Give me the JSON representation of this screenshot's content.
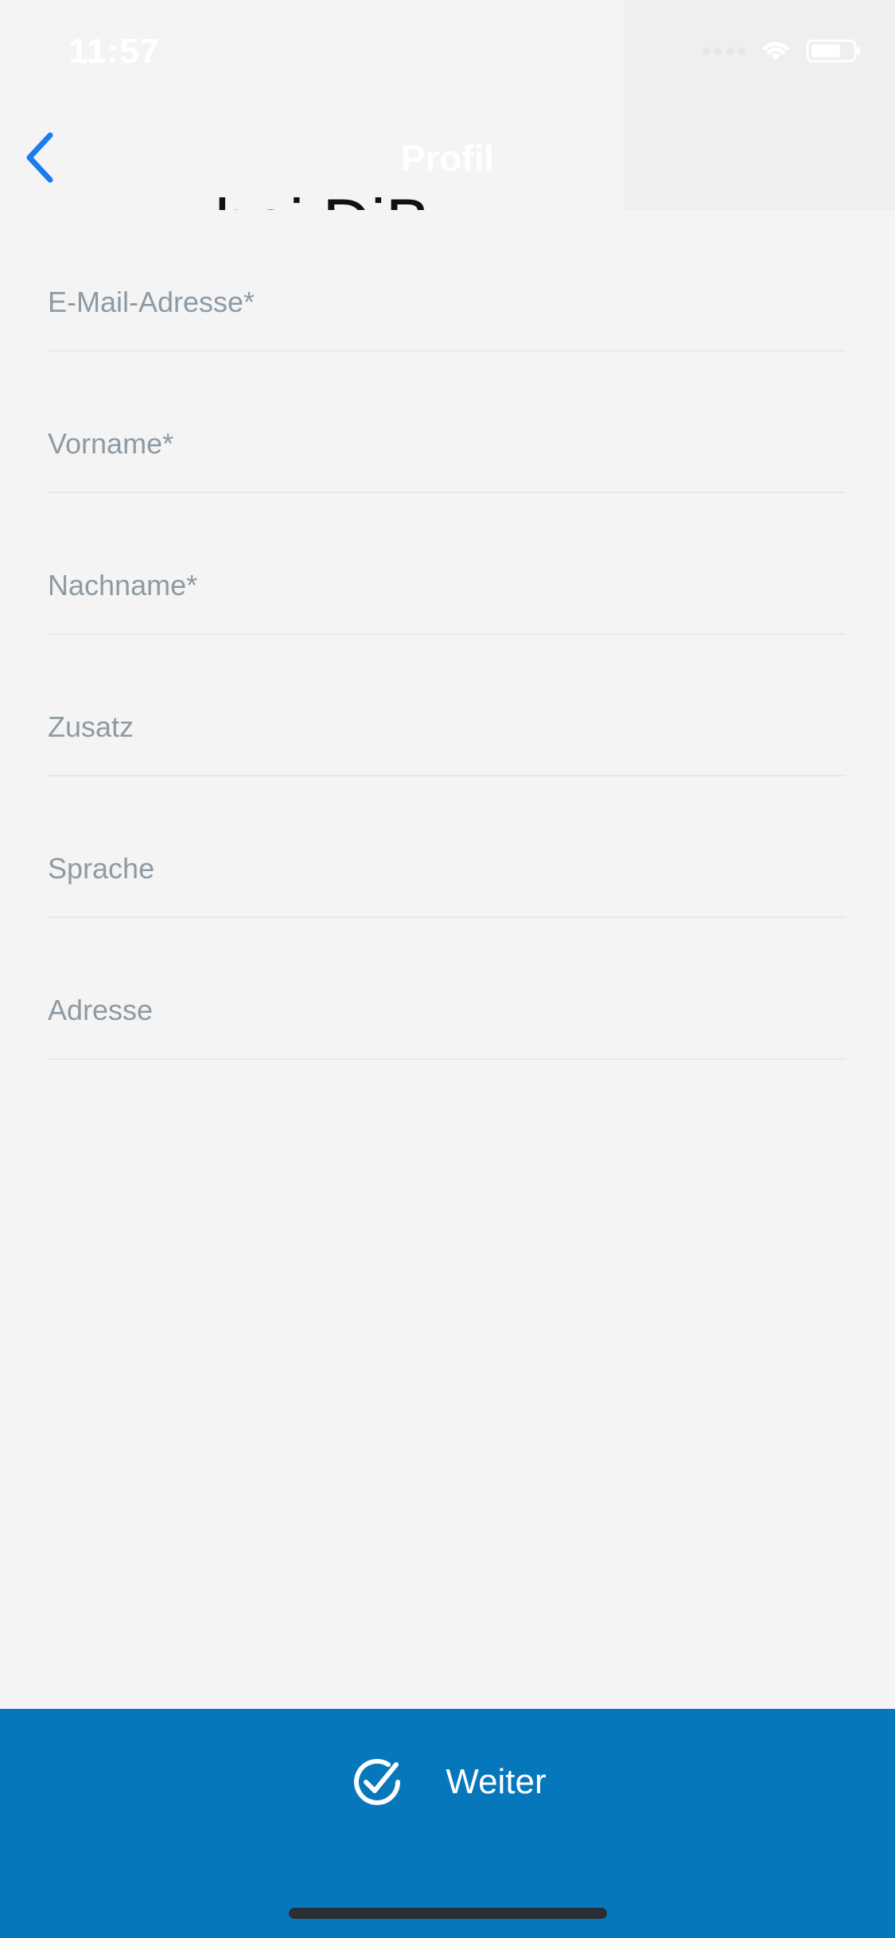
{
  "status_bar": {
    "time": "11:57"
  },
  "nav": {
    "title": "Profil",
    "ghost_heading": "...bei DiB",
    "back_icon": "chevron-left-icon"
  },
  "form": {
    "fields": [
      {
        "label": "E-Mail-Adresse*",
        "value": ""
      },
      {
        "label": "Vorname*",
        "value": ""
      },
      {
        "label": "Nachname*",
        "value": ""
      },
      {
        "label": "Zusatz",
        "value": ""
      },
      {
        "label": "Sprache",
        "value": ""
      },
      {
        "label": "Adresse",
        "value": ""
      }
    ]
  },
  "footer": {
    "button_label": "Weiter",
    "button_icon": "check-circle-icon"
  },
  "colors": {
    "accent": "#0777bc",
    "back_icon": "#1a7cf0",
    "label": "#8e9aa3",
    "background": "#f4f4f4"
  }
}
